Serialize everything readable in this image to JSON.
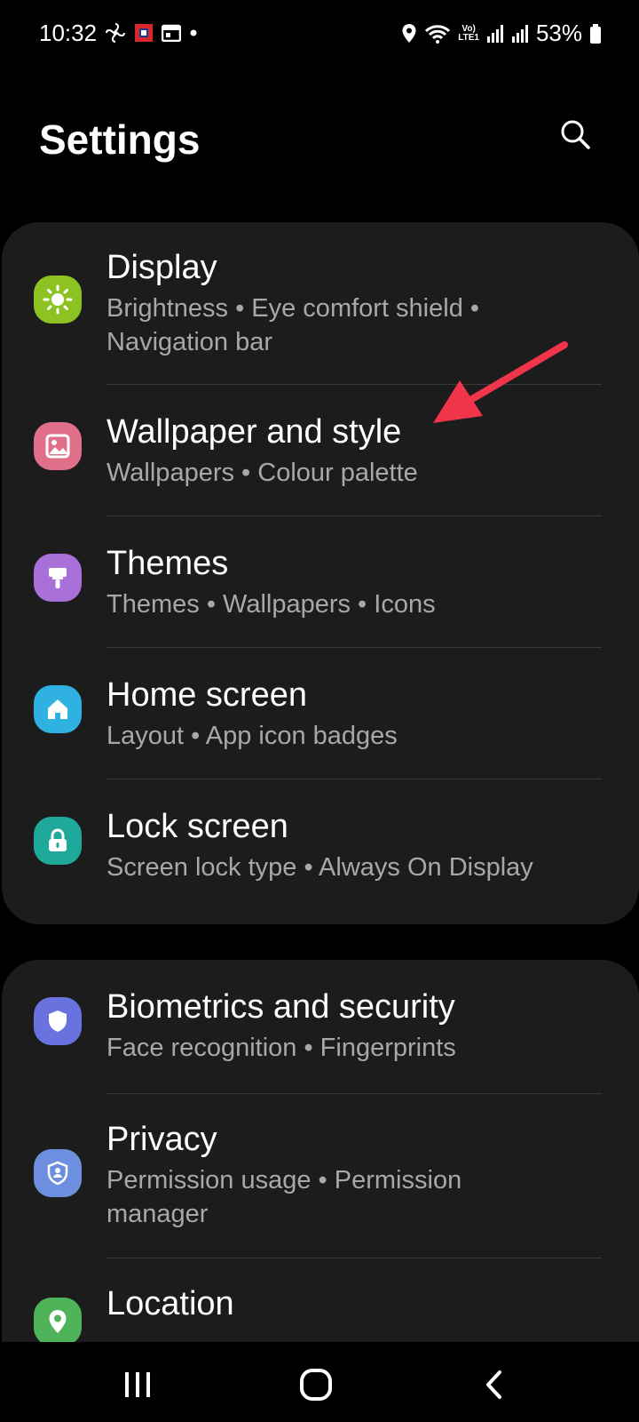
{
  "status_bar": {
    "time": "10:32",
    "battery_percent": "53%",
    "volte_line1": "Vo)",
    "volte_line2": "LTE1"
  },
  "header": {
    "title": "Settings"
  },
  "colors": {
    "display": "#8cc322",
    "wallpaper": "#e0708a",
    "themes": "#a870d8",
    "home_screen": "#2fb1e2",
    "lock_screen": "#1fa99a",
    "biometrics": "#6a72e0",
    "privacy": "#6e8fe0",
    "location": "#4fb35a",
    "annotation_arrow": "#f0344a"
  },
  "settings_group_1": [
    {
      "title": "Display",
      "subtitle": "Brightness  •  Eye comfort shield  •  Navigation bar",
      "icon": "sun-icon"
    },
    {
      "title": "Wallpaper and style",
      "subtitle": "Wallpapers  •  Colour palette",
      "icon": "image-icon"
    },
    {
      "title": "Themes",
      "subtitle": "Themes  •  Wallpapers  •  Icons",
      "icon": "paintbrush-icon"
    },
    {
      "title": "Home screen",
      "subtitle": "Layout  •  App icon badges",
      "icon": "home-icon"
    },
    {
      "title": "Lock screen",
      "subtitle": "Screen lock type  •  Always On Display",
      "icon": "lock-icon"
    }
  ],
  "settings_group_2": [
    {
      "title": "Biometrics and security",
      "subtitle": "Face recognition  •  Fingerprints",
      "icon": "shield-icon"
    },
    {
      "title": "Privacy",
      "subtitle": "Permission usage  •  Permission manager",
      "icon": "privacy-shield-icon"
    },
    {
      "title": "Location",
      "subtitle": "",
      "icon": "location-pin-icon"
    }
  ],
  "navigation": {
    "recents": "recents-icon",
    "home": "home-button-icon",
    "back": "back-icon"
  }
}
